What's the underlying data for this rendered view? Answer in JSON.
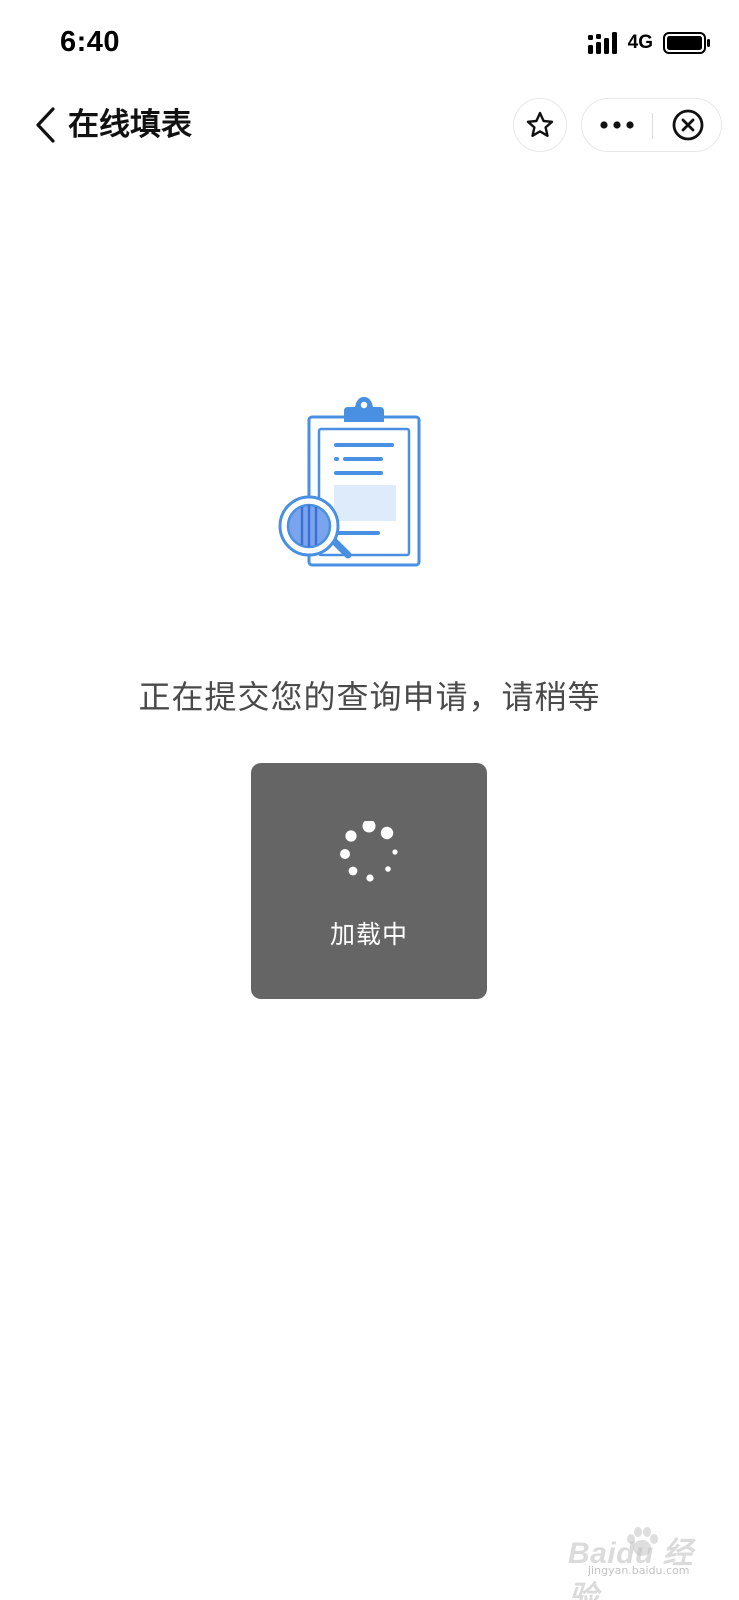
{
  "status_bar": {
    "time": "6:40",
    "network": "4G",
    "icons": [
      "signal-icon",
      "battery-icon"
    ]
  },
  "nav": {
    "title": "在线填表",
    "icons": [
      "chevron-left-icon",
      "star-icon",
      "more-icon",
      "close-circle-icon"
    ]
  },
  "content": {
    "illustration_icon": "clipboard-search-icon",
    "message": "正在提交您的查询申请，请稍等"
  },
  "loading": {
    "label": "加载中",
    "icon": "spinner-icon"
  },
  "watermark": {
    "brand": "Baidu 经验",
    "url": "jingyan.baidu.com"
  },
  "colors": {
    "illustration_blue": "#4a90e2",
    "illustration_light_blue": "#deebfb",
    "toast_background": "#656565",
    "message_text": "#4a4a4a"
  }
}
